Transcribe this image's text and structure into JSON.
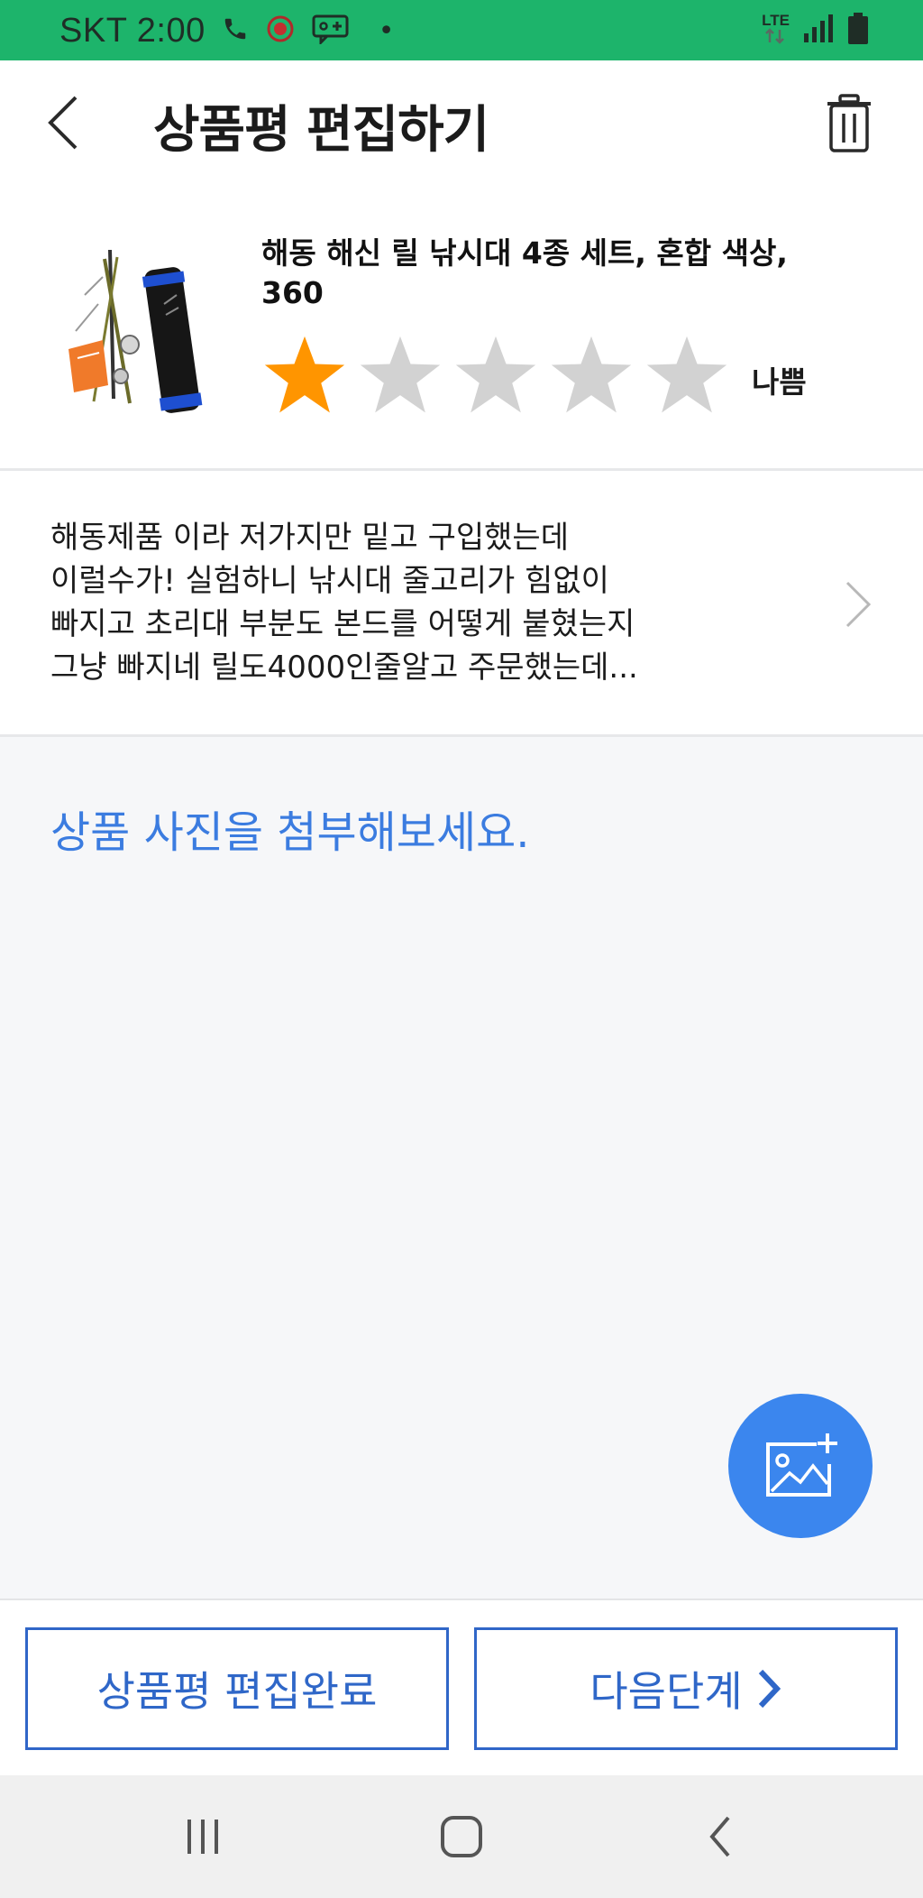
{
  "status_bar": {
    "carrier_time": "SKT 2:00",
    "network": "LTE",
    "dot": "•",
    "icons": [
      "phone-icon",
      "record-icon",
      "chat-add-icon",
      "dot-icon",
      "lte-arrows-icon",
      "signal-icon",
      "battery-icon"
    ]
  },
  "header": {
    "title": "상품평 편집하기",
    "back_icon": "chevron-left-icon",
    "delete_icon": "trash-icon"
  },
  "product": {
    "name": "해동 해신 릴 낚시대 4종 세트, 혼합 색상, 360",
    "rating": 1,
    "rating_max": 5,
    "rating_label": "나쁨",
    "colors": {
      "star_filled": "#ff9500",
      "star_empty": "#d2d2d2"
    }
  },
  "review": {
    "text": "해동제품 이라 저가지만 밑고 구입했는데\n이럴수가! 실험하니 낚시대 줄고리가 힘없이\n빠지고 초리대 부분도 본드를 어떻게 붙혔는지\n그냥 빠지네 릴도4000인줄알고  주문했는데..."
  },
  "photo": {
    "prompt": "상품 사진을 첨부해보세요.",
    "add_icon": "add-image-icon",
    "accent": "#3b86ee"
  },
  "actions": {
    "complete_label": "상품평 편집완료",
    "next_label": "다음단계",
    "next_icon": "chevron-right-icon",
    "accent": "#2f67c8"
  },
  "nav": {
    "icons": [
      "recent-apps-icon",
      "home-icon",
      "back-icon"
    ]
  }
}
